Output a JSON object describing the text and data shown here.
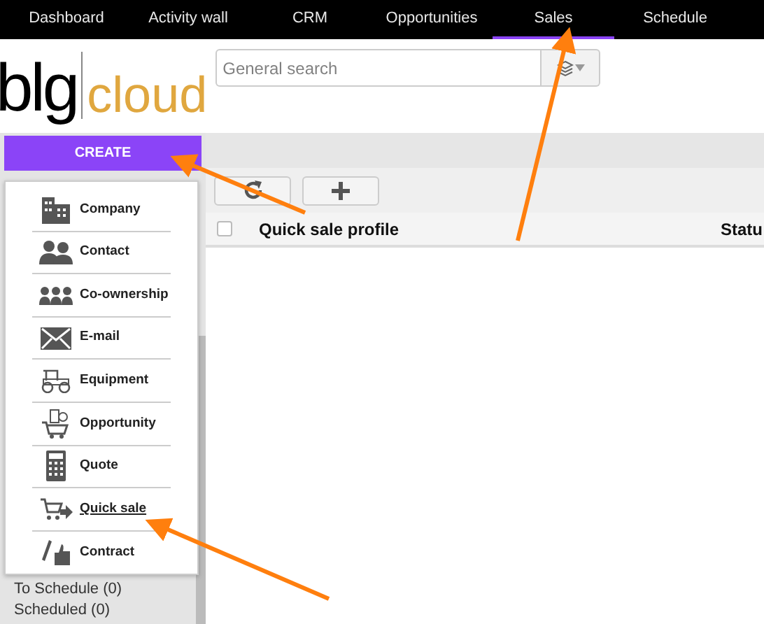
{
  "nav": [
    {
      "label": "Dashboard",
      "selected": false
    },
    {
      "label": "Activity wall",
      "selected": false
    },
    {
      "label": "CRM",
      "selected": false
    },
    {
      "label": "Opportunities",
      "selected": false
    },
    {
      "label": "Sales",
      "selected": true
    },
    {
      "label": "Schedule",
      "selected": false
    }
  ],
  "logo": {
    "left": "blg",
    "right": "cloud"
  },
  "search": {
    "placeholder": "General search"
  },
  "create_button": "CREATE",
  "create_menu": [
    {
      "label": "Company",
      "kind": "company",
      "selected": false
    },
    {
      "label": "Contact",
      "kind": "contact",
      "selected": false
    },
    {
      "label": "Co-ownership",
      "kind": "group",
      "selected": false
    },
    {
      "label": "E-mail",
      "kind": "email",
      "selected": false
    },
    {
      "label": "Equipment",
      "kind": "equipment",
      "selected": false
    },
    {
      "label": "Opportunity",
      "kind": "opportunity",
      "selected": false
    },
    {
      "label": "Quote",
      "kind": "quote",
      "selected": false
    },
    {
      "label": "Quick sale",
      "kind": "quicksale",
      "selected": true
    },
    {
      "label": "Contract",
      "kind": "contract",
      "selected": false
    }
  ],
  "sidebar": {
    "items": [
      "To Schedule (0)",
      "Scheduled (0)"
    ]
  },
  "table": {
    "select_all_checked": false,
    "columns": [
      "Quick sale profile",
      "Statu"
    ]
  }
}
